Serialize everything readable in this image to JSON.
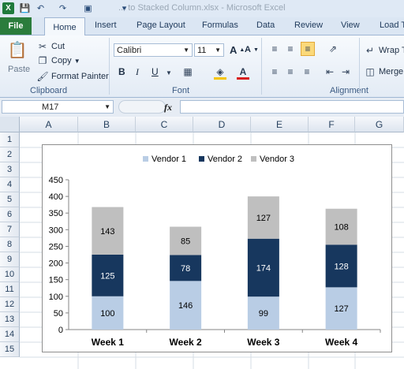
{
  "app": {
    "window_title": "... to Stacked Column.xlsx - Microsoft Excel",
    "excel_icon": "X",
    "quick_access": [
      "save-icon",
      "undo-icon",
      "redo-icon",
      "camera-icon",
      "customize-icon"
    ]
  },
  "tabs": [
    "File",
    "Home",
    "Insert",
    "Page Layout",
    "Formulas",
    "Data",
    "Review",
    "View",
    "Load T"
  ],
  "ribbon": {
    "clipboard": {
      "paste": "Paste",
      "cut": "Cut",
      "copy": "Copy",
      "format_painter": "Format Painter",
      "label": "Clipboard"
    },
    "font": {
      "name": "Calibri",
      "size": "11",
      "bold": "B",
      "italic": "I",
      "underline": "U",
      "label": "Font"
    },
    "alignment": {
      "wrap": "Wrap T",
      "merge": "Merge",
      "label": "Alignment"
    }
  },
  "formula_bar": {
    "name_box": "M17",
    "fx": "fx",
    "content": ""
  },
  "sheet": {
    "columns": [
      "A",
      "B",
      "C",
      "D",
      "E",
      "F",
      "G"
    ],
    "rows": [
      "1",
      "2",
      "3",
      "4",
      "5",
      "6",
      "7",
      "8",
      "9",
      "10",
      "11",
      "12",
      "13",
      "14",
      "15"
    ]
  },
  "colors": {
    "vendor1": "#b9cde5",
    "vendor2": "#17375e",
    "vendor3": "#bfbfbf"
  },
  "chart_data": {
    "type": "bar",
    "stacked": true,
    "categories": [
      "Week 1",
      "Week 2",
      "Week 3",
      "Week 4"
    ],
    "series": [
      {
        "name": "Vendor 1",
        "values": [
          100,
          146,
          99,
          127
        ]
      },
      {
        "name": "Vendor 2",
        "values": [
          125,
          78,
          174,
          128
        ]
      },
      {
        "name": "Vendor 3",
        "values": [
          143,
          85,
          127,
          108
        ]
      }
    ],
    "ylim": [
      0,
      450
    ],
    "yticks": [
      0,
      50,
      100,
      150,
      200,
      250,
      300,
      350,
      400,
      450
    ],
    "legend": "top",
    "grid": false
  }
}
